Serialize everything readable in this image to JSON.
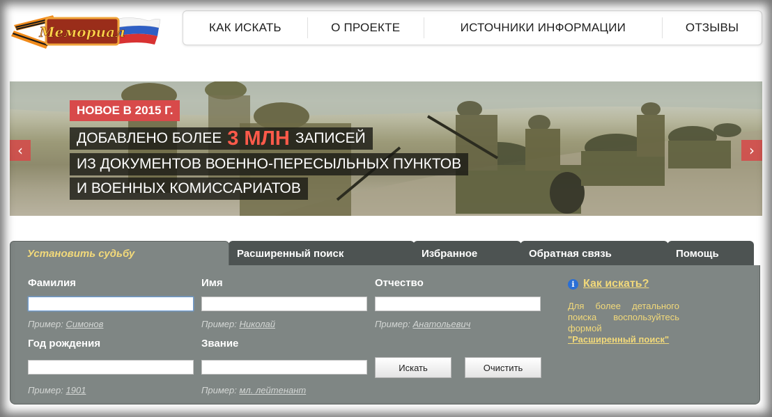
{
  "logo": {
    "text": "Мемориал"
  },
  "nav": {
    "items": [
      "КАК ИСКАТЬ",
      "О ПРОЕКТЕ",
      "ИСТОЧНИКИ ИНФОРМАЦИИ",
      "ОТЗЫВЫ"
    ]
  },
  "banner": {
    "tag": "НОВОЕ В 2015 Г.",
    "line1_pre": "ДОБАВЛЕНО БОЛЕЕ",
    "line1_big": "3 МЛН",
    "line1_post": "ЗАПИСЕЙ",
    "line2": "ИЗ ДОКУМЕНТОВ ВОЕННО-ПЕРЕСЫЛЬНЫХ ПУНКТОВ",
    "line3": "И ВОЕННЫХ КОМИССАРИАТОВ",
    "prev": "‹",
    "next": "›"
  },
  "tabs": [
    "Установить судьбу",
    "Расширенный поиск",
    "Избранное",
    "Обратная связь",
    "Помощь"
  ],
  "form": {
    "surname": {
      "label": "Фамилия",
      "value": "",
      "example_prefix": "Пример:",
      "example": "Симонов"
    },
    "name": {
      "label": "Имя",
      "value": "",
      "example_prefix": "Пример:",
      "example": "Николай"
    },
    "patronymic": {
      "label": "Отчество",
      "value": "",
      "example_prefix": "Пример:",
      "example": "Анатольевич"
    },
    "birth_year": {
      "label": "Год рождения",
      "value": "",
      "example_prefix": "Пример:",
      "example": "1901"
    },
    "rank": {
      "label": "Звание",
      "value": "",
      "example_prefix": "Пример:",
      "example": "мл. лейтенант"
    },
    "search_button": "Искать",
    "clear_button": "Очистить"
  },
  "help": {
    "title": "Как искать?",
    "text": "Для более детального поиска воспользуйтесь формой",
    "link": "\"Расширенный поиск\""
  },
  "colors": {
    "accent_red": "#d84a4a",
    "panel_bg": "#7f8684",
    "tab_bg": "#4d5352",
    "highlight_yellow": "#f2d97a"
  }
}
